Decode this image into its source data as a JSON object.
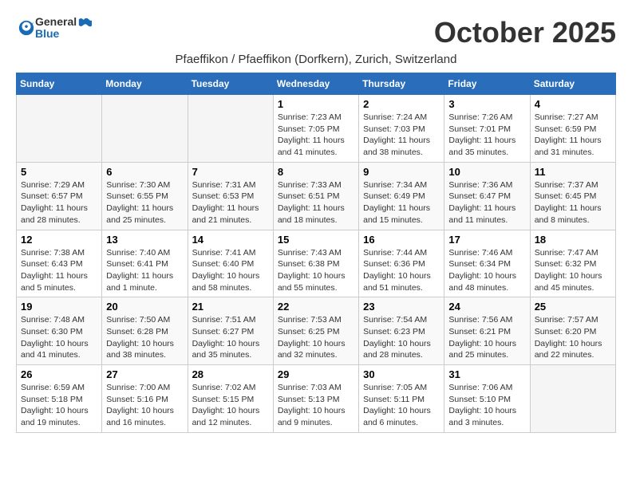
{
  "header": {
    "logo_general": "General",
    "logo_blue": "Blue",
    "title": "October 2025",
    "subtitle": "Pfaeffikon / Pfaeffikon (Dorfkern), Zurich, Switzerland"
  },
  "columns": [
    "Sunday",
    "Monday",
    "Tuesday",
    "Wednesday",
    "Thursday",
    "Friday",
    "Saturday"
  ],
  "weeks": [
    [
      {
        "day": "",
        "sunrise": "",
        "sunset": "",
        "daylight": ""
      },
      {
        "day": "",
        "sunrise": "",
        "sunset": "",
        "daylight": ""
      },
      {
        "day": "",
        "sunrise": "",
        "sunset": "",
        "daylight": ""
      },
      {
        "day": "1",
        "sunrise": "Sunrise: 7:23 AM",
        "sunset": "Sunset: 7:05 PM",
        "daylight": "Daylight: 11 hours and 41 minutes."
      },
      {
        "day": "2",
        "sunrise": "Sunrise: 7:24 AM",
        "sunset": "Sunset: 7:03 PM",
        "daylight": "Daylight: 11 hours and 38 minutes."
      },
      {
        "day": "3",
        "sunrise": "Sunrise: 7:26 AM",
        "sunset": "Sunset: 7:01 PM",
        "daylight": "Daylight: 11 hours and 35 minutes."
      },
      {
        "day": "4",
        "sunrise": "Sunrise: 7:27 AM",
        "sunset": "Sunset: 6:59 PM",
        "daylight": "Daylight: 11 hours and 31 minutes."
      }
    ],
    [
      {
        "day": "5",
        "sunrise": "Sunrise: 7:29 AM",
        "sunset": "Sunset: 6:57 PM",
        "daylight": "Daylight: 11 hours and 28 minutes."
      },
      {
        "day": "6",
        "sunrise": "Sunrise: 7:30 AM",
        "sunset": "Sunset: 6:55 PM",
        "daylight": "Daylight: 11 hours and 25 minutes."
      },
      {
        "day": "7",
        "sunrise": "Sunrise: 7:31 AM",
        "sunset": "Sunset: 6:53 PM",
        "daylight": "Daylight: 11 hours and 21 minutes."
      },
      {
        "day": "8",
        "sunrise": "Sunrise: 7:33 AM",
        "sunset": "Sunset: 6:51 PM",
        "daylight": "Daylight: 11 hours and 18 minutes."
      },
      {
        "day": "9",
        "sunrise": "Sunrise: 7:34 AM",
        "sunset": "Sunset: 6:49 PM",
        "daylight": "Daylight: 11 hours and 15 minutes."
      },
      {
        "day": "10",
        "sunrise": "Sunrise: 7:36 AM",
        "sunset": "Sunset: 6:47 PM",
        "daylight": "Daylight: 11 hours and 11 minutes."
      },
      {
        "day": "11",
        "sunrise": "Sunrise: 7:37 AM",
        "sunset": "Sunset: 6:45 PM",
        "daylight": "Daylight: 11 hours and 8 minutes."
      }
    ],
    [
      {
        "day": "12",
        "sunrise": "Sunrise: 7:38 AM",
        "sunset": "Sunset: 6:43 PM",
        "daylight": "Daylight: 11 hours and 5 minutes."
      },
      {
        "day": "13",
        "sunrise": "Sunrise: 7:40 AM",
        "sunset": "Sunset: 6:41 PM",
        "daylight": "Daylight: 11 hours and 1 minute."
      },
      {
        "day": "14",
        "sunrise": "Sunrise: 7:41 AM",
        "sunset": "Sunset: 6:40 PM",
        "daylight": "Daylight: 10 hours and 58 minutes."
      },
      {
        "day": "15",
        "sunrise": "Sunrise: 7:43 AM",
        "sunset": "Sunset: 6:38 PM",
        "daylight": "Daylight: 10 hours and 55 minutes."
      },
      {
        "day": "16",
        "sunrise": "Sunrise: 7:44 AM",
        "sunset": "Sunset: 6:36 PM",
        "daylight": "Daylight: 10 hours and 51 minutes."
      },
      {
        "day": "17",
        "sunrise": "Sunrise: 7:46 AM",
        "sunset": "Sunset: 6:34 PM",
        "daylight": "Daylight: 10 hours and 48 minutes."
      },
      {
        "day": "18",
        "sunrise": "Sunrise: 7:47 AM",
        "sunset": "Sunset: 6:32 PM",
        "daylight": "Daylight: 10 hours and 45 minutes."
      }
    ],
    [
      {
        "day": "19",
        "sunrise": "Sunrise: 7:48 AM",
        "sunset": "Sunset: 6:30 PM",
        "daylight": "Daylight: 10 hours and 41 minutes."
      },
      {
        "day": "20",
        "sunrise": "Sunrise: 7:50 AM",
        "sunset": "Sunset: 6:28 PM",
        "daylight": "Daylight: 10 hours and 38 minutes."
      },
      {
        "day": "21",
        "sunrise": "Sunrise: 7:51 AM",
        "sunset": "Sunset: 6:27 PM",
        "daylight": "Daylight: 10 hours and 35 minutes."
      },
      {
        "day": "22",
        "sunrise": "Sunrise: 7:53 AM",
        "sunset": "Sunset: 6:25 PM",
        "daylight": "Daylight: 10 hours and 32 minutes."
      },
      {
        "day": "23",
        "sunrise": "Sunrise: 7:54 AM",
        "sunset": "Sunset: 6:23 PM",
        "daylight": "Daylight: 10 hours and 28 minutes."
      },
      {
        "day": "24",
        "sunrise": "Sunrise: 7:56 AM",
        "sunset": "Sunset: 6:21 PM",
        "daylight": "Daylight: 10 hours and 25 minutes."
      },
      {
        "day": "25",
        "sunrise": "Sunrise: 7:57 AM",
        "sunset": "Sunset: 6:20 PM",
        "daylight": "Daylight: 10 hours and 22 minutes."
      }
    ],
    [
      {
        "day": "26",
        "sunrise": "Sunrise: 6:59 AM",
        "sunset": "Sunset: 5:18 PM",
        "daylight": "Daylight: 10 hours and 19 minutes."
      },
      {
        "day": "27",
        "sunrise": "Sunrise: 7:00 AM",
        "sunset": "Sunset: 5:16 PM",
        "daylight": "Daylight: 10 hours and 16 minutes."
      },
      {
        "day": "28",
        "sunrise": "Sunrise: 7:02 AM",
        "sunset": "Sunset: 5:15 PM",
        "daylight": "Daylight: 10 hours and 12 minutes."
      },
      {
        "day": "29",
        "sunrise": "Sunrise: 7:03 AM",
        "sunset": "Sunset: 5:13 PM",
        "daylight": "Daylight: 10 hours and 9 minutes."
      },
      {
        "day": "30",
        "sunrise": "Sunrise: 7:05 AM",
        "sunset": "Sunset: 5:11 PM",
        "daylight": "Daylight: 10 hours and 6 minutes."
      },
      {
        "day": "31",
        "sunrise": "Sunrise: 7:06 AM",
        "sunset": "Sunset: 5:10 PM",
        "daylight": "Daylight: 10 hours and 3 minutes."
      },
      {
        "day": "",
        "sunrise": "",
        "sunset": "",
        "daylight": ""
      }
    ]
  ]
}
